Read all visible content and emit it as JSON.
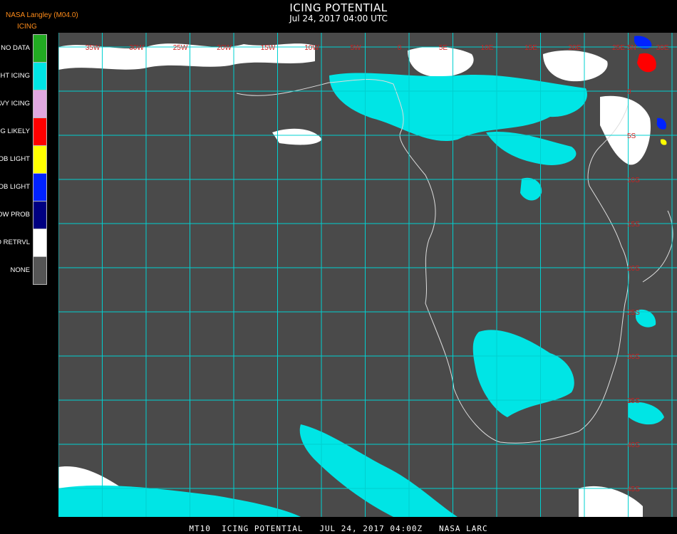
{
  "header": {
    "title": "ICING POTENTIAL",
    "date": "Jul 24, 2017 04:00 UTC",
    "source": "NASA Langley (M04.0)"
  },
  "legend": {
    "title": "ICING",
    "items": [
      {
        "label": "NO DATA",
        "color": "#22aa22"
      },
      {
        "label": "NIGHT ICING",
        "color": "#00e5e5"
      },
      {
        "label": "HEAVY ICING",
        "color": "#e0a8e0"
      },
      {
        "label": "MOG LIKELY",
        "color": "#ff0000"
      },
      {
        "label": "HI PROB LIGHT",
        "color": "#ffff00"
      },
      {
        "label": "LO PROB LIGHT",
        "color": "#0022ff"
      },
      {
        "label": "LOW PROB",
        "color": "#000080"
      },
      {
        "label": "NO RETRVL",
        "color": "#ffffff"
      },
      {
        "label": "NONE",
        "color": "#555555"
      }
    ]
  },
  "map": {
    "background": "#4a4a4a",
    "grid_color": "#00d0d0",
    "label_color": "#cc2222",
    "coast_color": "#dddddd",
    "lon_labels": [
      "35W",
      "30W",
      "25W",
      "20W",
      "15W",
      "10W",
      "5W",
      "0",
      "5E",
      "10E",
      "15E",
      "20E",
      "25E",
      "30E",
      "35E"
    ],
    "lat_labels": [
      "5N",
      "0",
      "5S",
      "10S",
      "15S",
      "20S",
      "25S",
      "30S",
      "35S",
      "40S",
      "45S"
    ]
  },
  "footer": "MT10  ICING POTENTIAL   JUL 24, 2017 04:00Z   NASA LARC"
}
